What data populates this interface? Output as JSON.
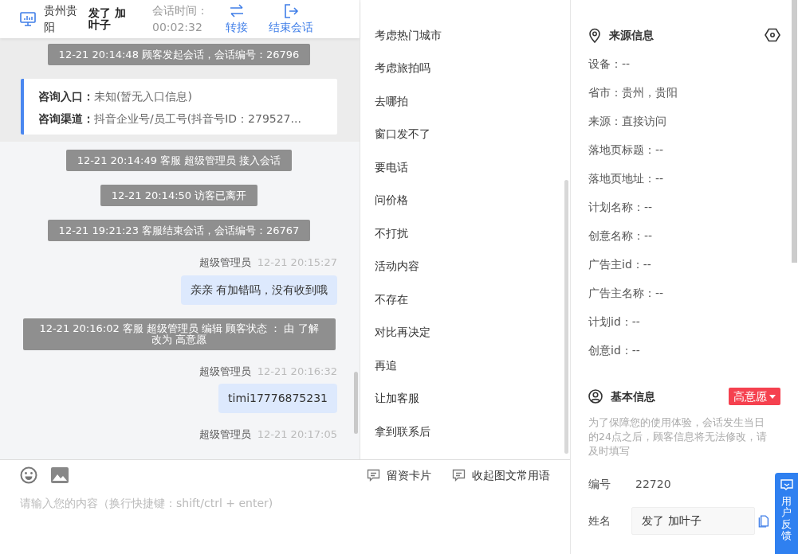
{
  "header": {
    "region": "贵州贵阳",
    "customer": "发了 加叶子",
    "duration_label": "会话时间：",
    "duration": "00:02:32",
    "actions": [
      {
        "kind": "transfer",
        "label": "转接"
      },
      {
        "kind": "end",
        "label": "结束会话"
      }
    ]
  },
  "session_start": {
    "notice": "12-21 20:14:48 顾客发起会话，会话编号：26796",
    "entry": [
      {
        "label": "咨询入口：",
        "value": "未知(暂无入口信息)"
      },
      {
        "label": "咨询渠道：",
        "value": "抖音企业号/员工号(抖音号ID：279527..."
      }
    ]
  },
  "messages": [
    {
      "kind": "system",
      "text": "12-21 20:14:49 客服 超级管理员 接入会话"
    },
    {
      "kind": "system",
      "text": "12-21 20:14:50 访客已离开"
    },
    {
      "kind": "system",
      "text": "12-21 19:21:23 客服结束会话，会话编号：26767"
    },
    {
      "kind": "agent",
      "sender": "超级管理员",
      "time": "12-21 20:15:27",
      "text": "亲亲 有加错吗，没有收到哦"
    },
    {
      "kind": "system",
      "text": "12-21 20:16:02 客服 超级管理员 编辑 顾客状态 ： 由 了解改为 高意愿"
    },
    {
      "kind": "agent",
      "sender": "超级管理员",
      "time": "12-21 20:16:32",
      "text": "timi17776875231"
    },
    {
      "kind": "agent",
      "sender": "超级管理员",
      "time": "12-21 20:17:05"
    }
  ],
  "phrases": [
    "考虑热门城市",
    "考虑旅拍吗",
    "去哪拍",
    "窗口发不了",
    "要电话",
    "问价格",
    "不打扰",
    "活动内容",
    "不存在",
    "对比再决定",
    "再追",
    "让加客服",
    "拿到联系后"
  ],
  "composer": {
    "tools": [
      {
        "kind": "emoji"
      },
      {
        "kind": "image"
      }
    ],
    "actions": [
      "留资卡片",
      "收起图文常用语"
    ],
    "placeholder": "请输入您的内容（换行快捷键：shift/ctrl + enter)"
  },
  "source_info": {
    "title": "来源信息",
    "fields": [
      "设备：--",
      "省市：贵州，贵阳",
      "来源：直接访问",
      "落地页标题：--",
      "落地页地址：--",
      "计划名称：--",
      "创意名称：--",
      "广告主id：--",
      "广告主名称：--",
      "计划id：--",
      "创意id：--"
    ]
  },
  "basic_info": {
    "title": "基本信息",
    "status": {
      "label": "高意愿",
      "color": "#f5414f"
    },
    "hint": "为了保障您的使用体验，会话发生当日的24点之后，顾客信息将无法修改，请及时填写",
    "fields": [
      {
        "kind": "text",
        "label": "编号",
        "value": "22720"
      },
      {
        "kind": "input",
        "label": "姓名",
        "value": "发了 加叶子"
      }
    ]
  },
  "feedback": {
    "label": "用户反馈"
  }
}
